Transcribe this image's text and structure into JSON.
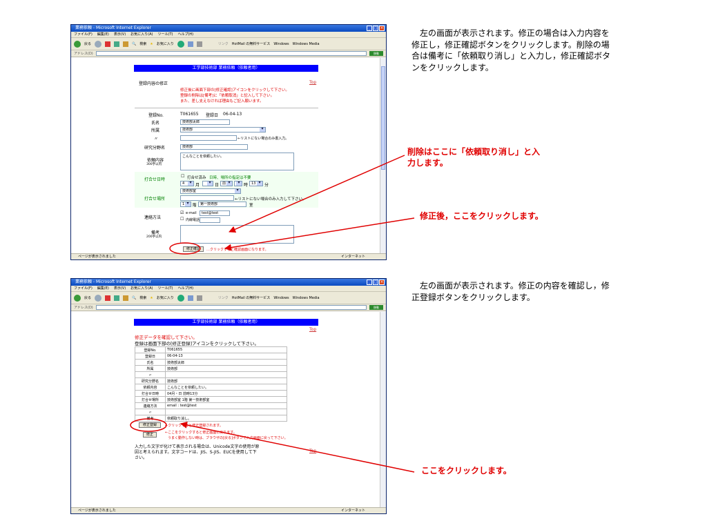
{
  "ie": {
    "title": "業務依頼 - Microsoft Internet Explorer",
    "menu": [
      "ファイル(F)",
      "編集(E)",
      "表示(V)",
      "お気に入り(A)",
      "ツール(T)",
      "ヘルプ(H)"
    ],
    "toolbar": {
      "back": "戻る",
      "search": "検索",
      "favorites": "お気に入り",
      "links": "リンク",
      "link_items": [
        "HotMail の無料サービス",
        "Windows",
        "Windows Media"
      ]
    },
    "address_label": "アドレス(D)",
    "go": "移動",
    "status_left": "ページが表示されました",
    "status_zone": "インターネット"
  },
  "page1": {
    "header": "工学部技術部 業務依頼（依頼者用）",
    "top_link": "Top",
    "section_label": "登録内容の修正",
    "notice": [
      "修正後に画面下部の[修正確認]アイコンをクリックして下さい。",
      "登録の削除は[備考]に「依頼取消」と記入して下さい。",
      "また、差し支えなければ理由もご記入願います。"
    ],
    "reg_label": "登録No.",
    "reg_no": "T061655",
    "reg_date_label": "登録日",
    "reg_date": "06-04-13",
    "name_label": "氏名",
    "name_value": "技術部太郎",
    "affil_label": "所属",
    "affil_value": "技術部",
    "ditto": "〃",
    "affil_note": "←リストにない場合のみ書入力。",
    "field_label": "研究分野名",
    "field_value": "技術部",
    "request_label": "依頼内容",
    "request_sub": "300字以内",
    "request_value": "こんなことを依頼したい。",
    "meet_label": "打合せ日時",
    "meet_check": "打合せ済み",
    "meet_hint": "日時、場所の指定は不要",
    "month": "4",
    "month_unit": "月",
    "day_unit": "日",
    "ampm": "前",
    "hour_unit": "時",
    "minute": "13",
    "minute_unit": "分",
    "place_label": "打合せ場所",
    "place_value": "技術部室",
    "place_note": "←リストにない場合のみ入力して下さい。",
    "floor": "1",
    "floor_unit": "階",
    "room": "第一技術部",
    "room_unit": "室",
    "contact_label": "連絡方法",
    "contact_email": "e-mail",
    "contact_email_value": "test@test",
    "contact_phone": "内線電話",
    "remarks_label": "備考",
    "remarks_sub": "200字以内",
    "confirm_button": "修正確認",
    "confirm_note": "…クリックすると確認画面になります。"
  },
  "page2": {
    "header": "工学部技術部 業務依頼（依頼者用）",
    "top_link": "Top",
    "intro_red": "修正データを確認して下さい。",
    "intro": "登録は画面下部の[修正登録]アイコンをクリックして下さい。",
    "rows": [
      {
        "k": "登録No.",
        "v": "T061655"
      },
      {
        "k": "登録日",
        "v": "06-04-13"
      },
      {
        "k": "氏名",
        "v": "技術部太郎"
      },
      {
        "k": "所属",
        "v": "技術部"
      },
      {
        "k": "〃",
        "v": ""
      },
      {
        "k": "研究分野名",
        "v": "技術部"
      },
      {
        "k": "依頼内容",
        "v": "こんなことを依頼したい。"
      },
      {
        "k": "打合せ日時",
        "v": "04月・日 前時13分"
      },
      {
        "k": "打合せ場所",
        "v": "技術部室 1階 第一技術部室"
      },
      {
        "k": "連絡方法",
        "v": "email : test@test"
      },
      {
        "k": "〃",
        "v": ""
      },
      {
        "k": "備考",
        "v": "依頼取り消し。"
      }
    ],
    "register_button": "修正登録",
    "register_note": "←クリックすると修正登録されます。",
    "fix_button": "修正",
    "fix_note1": "←ここをクリックすると修正画面に戻ります。",
    "fix_note2": "うまく動作しない時は、ブラウザの[戻る]ボタンで入力画面に戻って下さい。",
    "bottom_text": [
      "入力した文字が化けて表示される場合は、Unicode文字の使用が原",
      "因と考えられます。文字コードは、JIS、S-JIS、EUCを使用して下",
      "さい。"
    ],
    "bottom_link": "Top"
  },
  "explanations": {
    "top": [
      "左の画面が表示されます。修正の場合は入力内容を",
      "修正し，修正確認ボタンをクリックします。削除の場",
      "合は備考に「依頼取り消し」と入力し，修正確認ボタ",
      "ンをクリックします。"
    ],
    "bottom": [
      "左の画面が表示されます。修正の内容を確認し，修",
      "正登録ボタンをクリックします。"
    ]
  },
  "annotations": {
    "delete": [
      "削除はここに「依頼取り消し」と入",
      "力します。"
    ],
    "after_fix": "修正後，ここをクリックします。",
    "click_here": "ここをクリックします。"
  },
  "colors": {
    "annotation": "#e00000",
    "header": "#0000ff",
    "title_bar": "#0a4ac0"
  }
}
